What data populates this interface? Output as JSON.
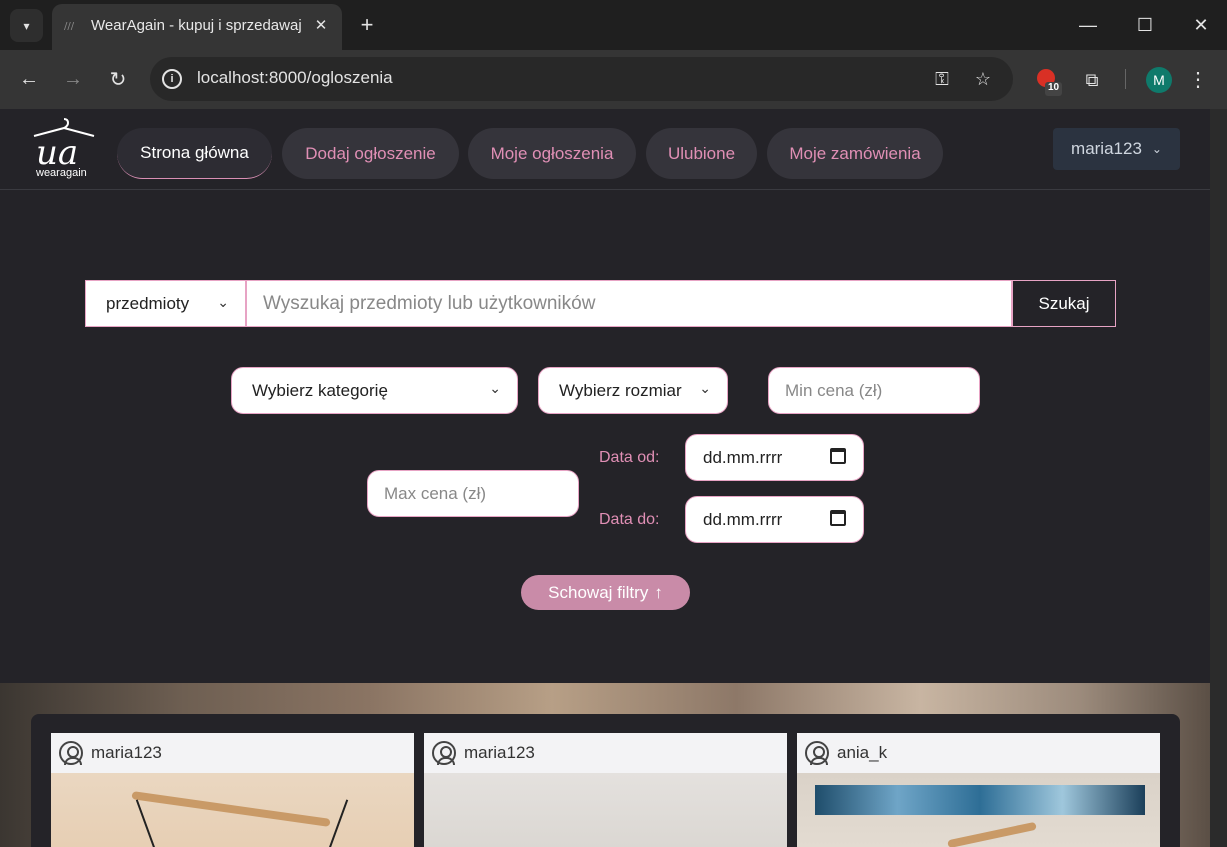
{
  "browser": {
    "tab_title": "WearAgain - kupuj i sprzedawaj",
    "url": "localhost:8000/ogloszenia",
    "extension_badge": "10",
    "profile_initial": "M"
  },
  "navbar": {
    "logo_mark": "ua",
    "logo_text": "wearagain",
    "items": [
      {
        "label": "Strona główna",
        "active": true
      },
      {
        "label": "Dodaj ogłoszenie",
        "active": false
      },
      {
        "label": "Moje ogłoszenia",
        "active": false
      },
      {
        "label": "Ulubione",
        "active": false
      },
      {
        "label": "Moje zamówienia",
        "active": false
      }
    ],
    "user": "maria123"
  },
  "search": {
    "scope": "przedmioty",
    "placeholder": "Wyszukaj przedmioty lub użytkowników",
    "button": "Szukaj"
  },
  "filters": {
    "category": "Wybierz kategorię",
    "size": "Wybierz rozmiar",
    "min_price_placeholder": "Min cena (zł)",
    "max_price_placeholder": "Max cena (zł)",
    "date_from_label": "Data od:",
    "date_to_label": "Data do:",
    "date_from_value": "dd.mm.rrrr",
    "date_to_value": "dd.mm.rrrr",
    "toggle_label": "Schowaj filtry",
    "toggle_icon": "arrow-up-icon"
  },
  "listings": [
    {
      "user": "maria123"
    },
    {
      "user": "maria123"
    },
    {
      "user": "ania_k"
    }
  ],
  "colors": {
    "accent": "#e08fb5",
    "toggle_bg": "#c98ba8",
    "panel_bg": "#242328"
  }
}
